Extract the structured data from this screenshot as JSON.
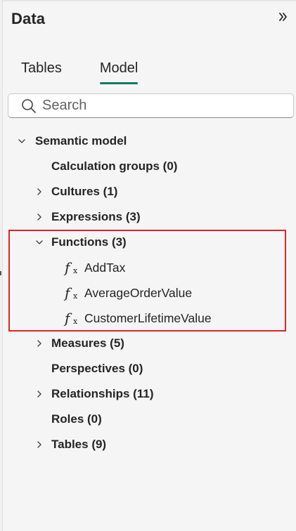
{
  "pane": {
    "title": "Data",
    "collapse_icon": "double-chevron-right-icon"
  },
  "tabs": [
    {
      "label": "Tables",
      "active": false
    },
    {
      "label": "Model",
      "active": true
    }
  ],
  "search": {
    "placeholder": "Search",
    "value": ""
  },
  "tree": {
    "root": {
      "label": "Semantic model",
      "expanded": true
    },
    "items": [
      {
        "label": "Calculation groups (0)",
        "expandable": false
      },
      {
        "label": "Cultures (1)",
        "expandable": true,
        "expanded": false
      },
      {
        "label": "Expressions (3)",
        "expandable": true,
        "expanded": false
      },
      {
        "label": "Functions (3)",
        "expandable": true,
        "expanded": true,
        "children": [
          {
            "label": "AddTax",
            "icon": "function-icon"
          },
          {
            "label": "AverageOrderValue",
            "icon": "function-icon"
          },
          {
            "label": "CustomerLifetimeValue",
            "icon": "function-icon"
          }
        ]
      },
      {
        "label": "Measures (5)",
        "expandable": true,
        "expanded": false
      },
      {
        "label": "Perspectives (0)",
        "expandable": false
      },
      {
        "label": "Relationships (11)",
        "expandable": true,
        "expanded": false
      },
      {
        "label": "Roles (0)",
        "expandable": false
      },
      {
        "label": "Tables (9)",
        "expandable": true,
        "expanded": false
      }
    ]
  },
  "colors": {
    "accent": "#117865",
    "highlight": "#e02424",
    "background": "#f5f5f5"
  }
}
